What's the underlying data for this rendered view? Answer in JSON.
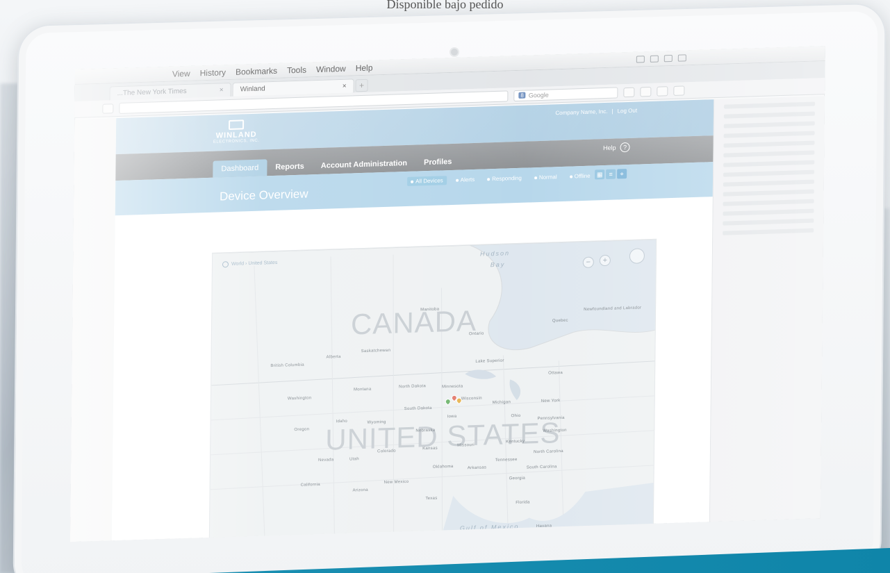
{
  "caption": "Disponible bajo pedido",
  "menubar": {
    "items": [
      "View",
      "History",
      "Bookmarks",
      "Tools",
      "Window",
      "Help"
    ]
  },
  "browser": {
    "tabs": [
      {
        "label": "...The New York Times",
        "close": "×"
      },
      {
        "label": "Winland",
        "close": "×"
      }
    ],
    "new_tab": "+",
    "search_placeholder": "Google",
    "search_engine": "8"
  },
  "app": {
    "logo": {
      "name": "WINLAND",
      "sub": "ELECTRONICS, INC."
    },
    "header": {
      "company": "Company Name, Inc.",
      "separator": "|",
      "logout": "Log Out"
    },
    "help": {
      "label": "Help",
      "icon": "?"
    },
    "nav": [
      "Dashboard",
      "Reports",
      "Account Administration",
      "Profiles"
    ],
    "page_title": "Device Overview",
    "filters": [
      "All Devices",
      "Alerts",
      "Responding",
      "Normal",
      "Offline"
    ],
    "view_toggle": {
      "grid": "▦",
      "list": "≡",
      "map": "⌖"
    },
    "map": {
      "breadcrumb": "World › United States",
      "countries": [
        "CANADA",
        "UNITED STATES"
      ],
      "water": [
        "Hudson",
        "Bay",
        "Gulf of Mexico"
      ],
      "labels": [
        "Manitoba",
        "Ontario",
        "Quebec",
        "Alberta",
        "Saskatchewan",
        "British Columbia",
        "Newfoundland and Labrador",
        "Washington",
        "Montana",
        "North Dakota",
        "Minnesota",
        "Wisconsin",
        "Michigan",
        "Oregon",
        "Idaho",
        "Wyoming",
        "South Dakota",
        "Iowa",
        "Nebraska",
        "Nevada",
        "Utah",
        "Colorado",
        "Kansas",
        "Missouri",
        "Kentucky",
        "California",
        "Arizona",
        "New Mexico",
        "Oklahoma",
        "Arkansas",
        "Tennessee",
        "Texas",
        "Ohio",
        "Ottawa",
        "Washington",
        "New York",
        "Pennsylvania",
        "North Carolina",
        "South Carolina",
        "Georgia",
        "Florida",
        "Havana",
        "Lake Superior"
      ],
      "zoom_out": "−",
      "zoom_in": "+"
    }
  }
}
